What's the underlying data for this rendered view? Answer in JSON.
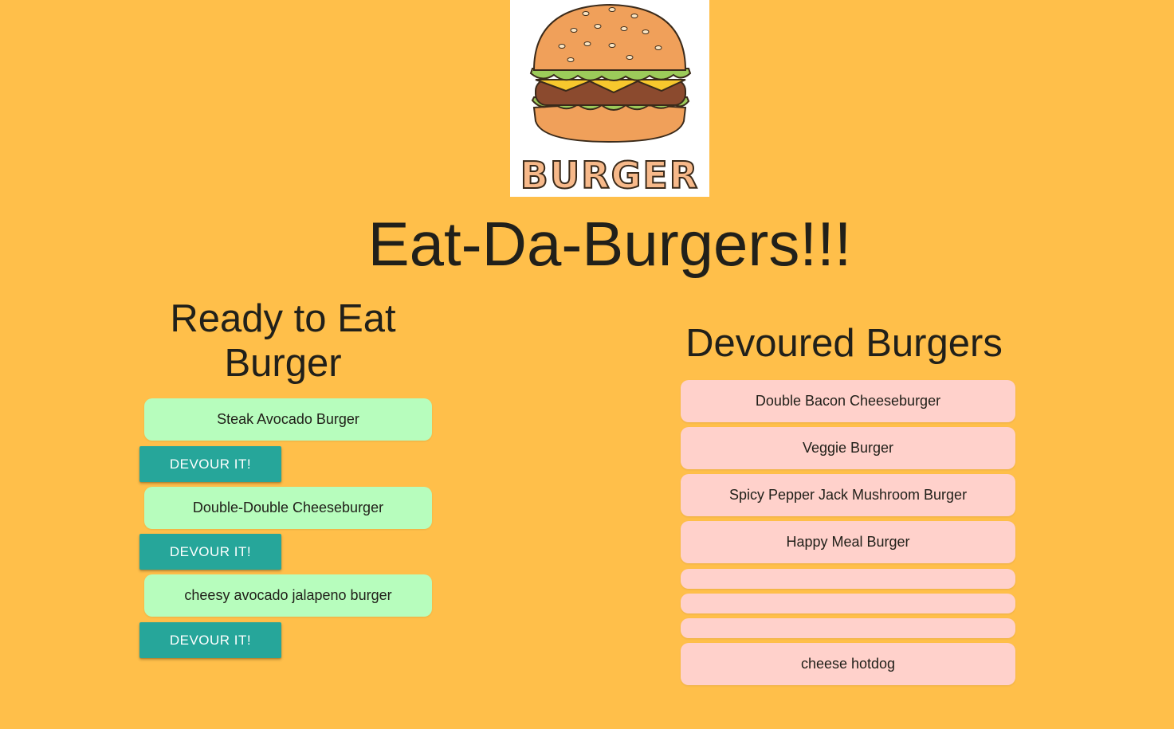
{
  "logo": {
    "text": "BURGER"
  },
  "page_title": "Eat-Da-Burgers!!!",
  "ready": {
    "heading": "Ready to Eat Burger",
    "burgers": [
      {
        "name": "Steak Avocado Burger"
      },
      {
        "name": "Double-Double Cheeseburger"
      },
      {
        "name": "cheesy avocado jalapeno burger"
      }
    ],
    "devour_label": "DEVOUR IT!"
  },
  "devoured": {
    "heading": "Devoured Burgers",
    "burgers": [
      {
        "name": "Double Bacon Cheeseburger"
      },
      {
        "name": "Veggie Burger"
      },
      {
        "name": "Spicy Pepper Jack Mushroom Burger"
      },
      {
        "name": "Happy Meal Burger"
      },
      {
        "name": ""
      },
      {
        "name": ""
      },
      {
        "name": ""
      },
      {
        "name": "cheese hotdog"
      }
    ]
  },
  "colors": {
    "background": "#FFBF4A",
    "ready_card": "#B7FDBD",
    "devour_button": "#26A69A",
    "devoured_card": "#FFD1CB"
  }
}
